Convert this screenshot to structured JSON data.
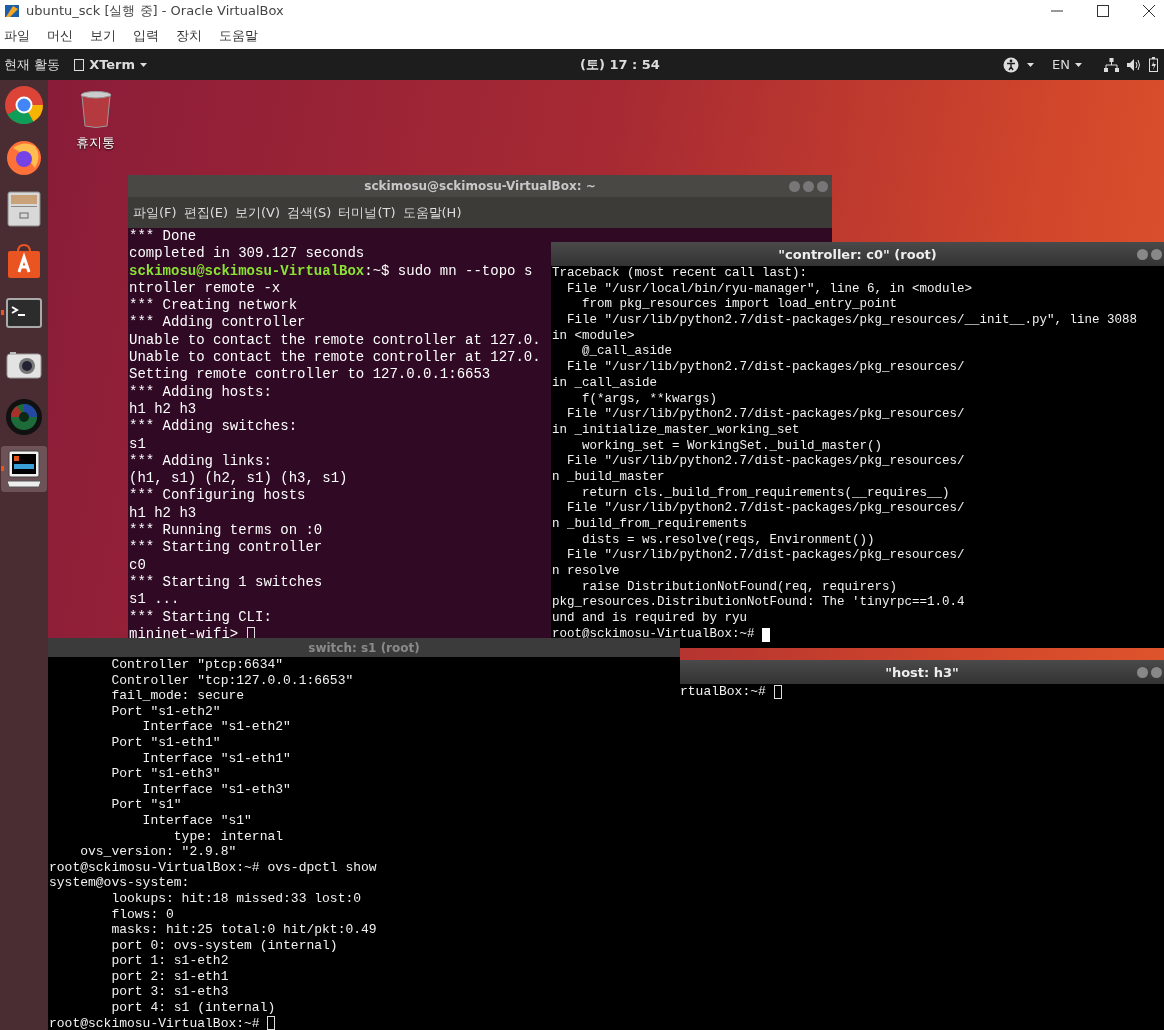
{
  "vbox": {
    "title": "ubuntu_sck [실행 중] - Oracle VirtualBox",
    "menu": [
      "파일",
      "머신",
      "보기",
      "입력",
      "장치",
      "도움말"
    ]
  },
  "topbar": {
    "activities": "현재 활동",
    "app": "XTerm",
    "clock": "(토) 17 : 54",
    "language": "EN"
  },
  "dock": [
    {
      "kind": "chrome",
      "selected": false,
      "running": false
    },
    {
      "kind": "firefox",
      "selected": false,
      "running": false
    },
    {
      "kind": "files",
      "selected": false,
      "running": false
    },
    {
      "kind": "software",
      "selected": false,
      "running": false
    },
    {
      "kind": "terminal",
      "selected": false,
      "running": true
    },
    {
      "kind": "camera",
      "selected": false,
      "running": false
    },
    {
      "kind": "webcam",
      "selected": false,
      "running": false
    },
    {
      "kind": "xterm",
      "selected": true,
      "running": true
    }
  ],
  "desktop_icons": [
    {
      "label": "휴지통"
    }
  ],
  "main_terminal": {
    "title": "sckimosu@sckimosu-VirtualBox: ~",
    "menu": [
      "파일(F)",
      "편집(E)",
      "보기(V)",
      "검색(S)",
      "터미널(T)",
      "도움말(H)"
    ],
    "lines": [
      {
        "kind": "text",
        "text": "*** Done"
      },
      {
        "kind": "text",
        "text": "completed in 309.127 seconds"
      },
      {
        "kind": "prompt",
        "user": "sckimosu@sckimosu-VirtualBox",
        "text": ":~$ sudo mn --topo s"
      },
      {
        "kind": "text",
        "text": "ntroller remote -x"
      },
      {
        "kind": "text",
        "text": "*** Creating network"
      },
      {
        "kind": "text",
        "text": "*** Adding controller"
      },
      {
        "kind": "text",
        "text": "Unable to contact the remote controller at 127.0."
      },
      {
        "kind": "text",
        "text": "Unable to contact the remote controller at 127.0."
      },
      {
        "kind": "text",
        "text": "Setting remote controller to 127.0.0.1:6653"
      },
      {
        "kind": "text",
        "text": "*** Adding hosts:"
      },
      {
        "kind": "text",
        "text": "h1 h2 h3"
      },
      {
        "kind": "text",
        "text": "*** Adding switches:"
      },
      {
        "kind": "text",
        "text": "s1"
      },
      {
        "kind": "text",
        "text": "*** Adding links:"
      },
      {
        "kind": "text",
        "text": "(h1, s1) (h2, s1) (h3, s1)"
      },
      {
        "kind": "text",
        "text": "*** Configuring hosts"
      },
      {
        "kind": "text",
        "text": "h1 h2 h3"
      },
      {
        "kind": "text",
        "text": "*** Running terms on :0"
      },
      {
        "kind": "text",
        "text": "*** Starting controller"
      },
      {
        "kind": "text",
        "text": "c0"
      },
      {
        "kind": "text",
        "text": "*** Starting 1 switches"
      },
      {
        "kind": "text",
        "text": "s1 ..."
      },
      {
        "kind": "text",
        "text": "*** Starting CLI:"
      },
      {
        "kind": "input",
        "text": "mininet-wifi> "
      }
    ]
  },
  "controller": {
    "title": "\"controller: c0\" (root)",
    "lines": [
      {
        "kind": "text",
        "text": "Traceback (most recent call last):"
      },
      {
        "kind": "text",
        "text": "  File \"/usr/local/bin/ryu-manager\", line 6, in <module>"
      },
      {
        "kind": "text",
        "text": "    from pkg_resources import load_entry_point"
      },
      {
        "kind": "text",
        "text": "  File \"/usr/lib/python2.7/dist-packages/pkg_resources/__init__.py\", line 3088"
      },
      {
        "kind": "text",
        "text": "in <module>"
      },
      {
        "kind": "text",
        "text": "    @_call_aside"
      },
      {
        "kind": "text",
        "text": "  File \"/usr/lib/python2.7/dist-packages/pkg_resources/"
      },
      {
        "kind": "text",
        "text": "in _call_aside"
      },
      {
        "kind": "text",
        "text": "    f(*args, **kwargs)"
      },
      {
        "kind": "text",
        "text": "  File \"/usr/lib/python2.7/dist-packages/pkg_resources/"
      },
      {
        "kind": "text",
        "text": "in _initialize_master_working_set"
      },
      {
        "kind": "text",
        "text": "    working_set = WorkingSet._build_master()"
      },
      {
        "kind": "text",
        "text": "  File \"/usr/lib/python2.7/dist-packages/pkg_resources/"
      },
      {
        "kind": "text",
        "text": "n _build_master"
      },
      {
        "kind": "text",
        "text": "    return cls._build_from_requirements(__requires__)"
      },
      {
        "kind": "text",
        "text": "  File \"/usr/lib/python2.7/dist-packages/pkg_resources/"
      },
      {
        "kind": "text",
        "text": "n _build_from_requirements"
      },
      {
        "kind": "text",
        "text": "    dists = ws.resolve(reqs, Environment())"
      },
      {
        "kind": "text",
        "text": "  File \"/usr/lib/python2.7/dist-packages/pkg_resources/"
      },
      {
        "kind": "text",
        "text": "n resolve"
      },
      {
        "kind": "text",
        "text": "    raise DistributionNotFound(req, requirers)"
      },
      {
        "kind": "text",
        "text": "pkg_resources.DistributionNotFound: The 'tinyrpc==1.0.4"
      },
      {
        "kind": "text",
        "text": "und and is required by ryu"
      },
      {
        "kind": "block",
        "text": "root@sckimosu-VirtualBox:~# "
      }
    ]
  },
  "switch_window": {
    "title": "switch: s1  (root)",
    "lines": [
      {
        "kind": "text",
        "text": "        Controller \"ptcp:6634\""
      },
      {
        "kind": "text",
        "text": "        Controller \"tcp:127.0.0.1:6653\""
      },
      {
        "kind": "text",
        "text": "        fail_mode: secure"
      },
      {
        "kind": "text",
        "text": "        Port \"s1-eth2\""
      },
      {
        "kind": "text",
        "text": "            Interface \"s1-eth2\""
      },
      {
        "kind": "text",
        "text": "        Port \"s1-eth1\""
      },
      {
        "kind": "text",
        "text": "            Interface \"s1-eth1\""
      },
      {
        "kind": "text",
        "text": "        Port \"s1-eth3\""
      },
      {
        "kind": "text",
        "text": "            Interface \"s1-eth3\""
      },
      {
        "kind": "text",
        "text": "        Port \"s1\""
      },
      {
        "kind": "text",
        "text": "            Interface \"s1\""
      },
      {
        "kind": "text",
        "text": "                type: internal"
      },
      {
        "kind": "text",
        "text": "    ovs_version: \"2.9.8\""
      },
      {
        "kind": "text",
        "text": "root@sckimosu-VirtualBox:~# ovs-dpctl show"
      },
      {
        "kind": "text",
        "text": "system@ovs-system:"
      },
      {
        "kind": "text",
        "text": "        lookups: hit:18 missed:33 lost:0"
      },
      {
        "kind": "text",
        "text": "        flows: 0"
      },
      {
        "kind": "text",
        "text": "        masks: hit:25 total:0 hit/pkt:0.49"
      },
      {
        "kind": "text",
        "text": "        port 0: ovs-system (internal)"
      },
      {
        "kind": "text",
        "text": "        port 1: s1-eth2"
      },
      {
        "kind": "text",
        "text": "        port 2: s1-eth1"
      },
      {
        "kind": "text",
        "text": "        port 3: s1-eth3"
      },
      {
        "kind": "text",
        "text": "        port 4: s1 (internal)"
      },
      {
        "kind": "input",
        "text": "root@sckimosu-VirtualBox:~# "
      }
    ]
  },
  "host_window": {
    "title": "\"host: h3\"",
    "lines": [
      {
        "kind": "input",
        "text": "rtualBox:~# "
      }
    ]
  }
}
